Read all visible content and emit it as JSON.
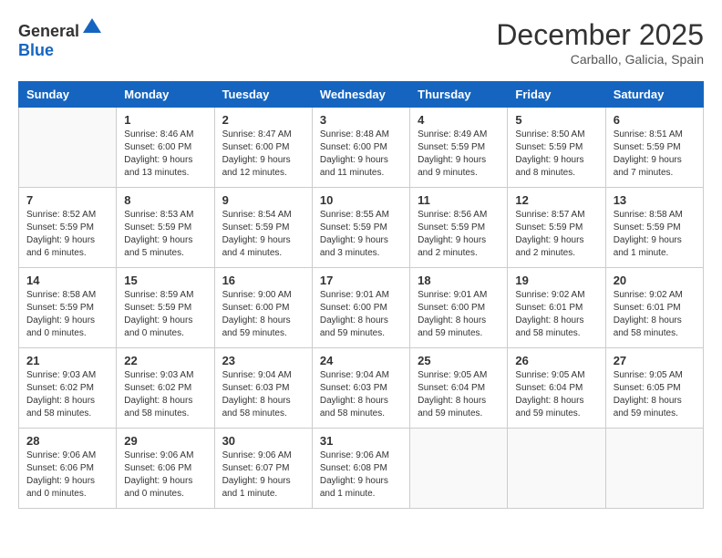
{
  "header": {
    "logo": {
      "general": "General",
      "blue": "Blue"
    },
    "title": "December 2025",
    "location": "Carballo, Galicia, Spain"
  },
  "calendar": {
    "days_of_week": [
      "Sunday",
      "Monday",
      "Tuesday",
      "Wednesday",
      "Thursday",
      "Friday",
      "Saturday"
    ],
    "weeks": [
      [
        {
          "day": "",
          "info": ""
        },
        {
          "day": "1",
          "info": "Sunrise: 8:46 AM\nSunset: 6:00 PM\nDaylight: 9 hours\nand 13 minutes."
        },
        {
          "day": "2",
          "info": "Sunrise: 8:47 AM\nSunset: 6:00 PM\nDaylight: 9 hours\nand 12 minutes."
        },
        {
          "day": "3",
          "info": "Sunrise: 8:48 AM\nSunset: 6:00 PM\nDaylight: 9 hours\nand 11 minutes."
        },
        {
          "day": "4",
          "info": "Sunrise: 8:49 AM\nSunset: 5:59 PM\nDaylight: 9 hours\nand 9 minutes."
        },
        {
          "day": "5",
          "info": "Sunrise: 8:50 AM\nSunset: 5:59 PM\nDaylight: 9 hours\nand 8 minutes."
        },
        {
          "day": "6",
          "info": "Sunrise: 8:51 AM\nSunset: 5:59 PM\nDaylight: 9 hours\nand 7 minutes."
        }
      ],
      [
        {
          "day": "7",
          "info": "Sunrise: 8:52 AM\nSunset: 5:59 PM\nDaylight: 9 hours\nand 6 minutes."
        },
        {
          "day": "8",
          "info": "Sunrise: 8:53 AM\nSunset: 5:59 PM\nDaylight: 9 hours\nand 5 minutes."
        },
        {
          "day": "9",
          "info": "Sunrise: 8:54 AM\nSunset: 5:59 PM\nDaylight: 9 hours\nand 4 minutes."
        },
        {
          "day": "10",
          "info": "Sunrise: 8:55 AM\nSunset: 5:59 PM\nDaylight: 9 hours\nand 3 minutes."
        },
        {
          "day": "11",
          "info": "Sunrise: 8:56 AM\nSunset: 5:59 PM\nDaylight: 9 hours\nand 2 minutes."
        },
        {
          "day": "12",
          "info": "Sunrise: 8:57 AM\nSunset: 5:59 PM\nDaylight: 9 hours\nand 2 minutes."
        },
        {
          "day": "13",
          "info": "Sunrise: 8:58 AM\nSunset: 5:59 PM\nDaylight: 9 hours\nand 1 minute."
        }
      ],
      [
        {
          "day": "14",
          "info": "Sunrise: 8:58 AM\nSunset: 5:59 PM\nDaylight: 9 hours\nand 0 minutes."
        },
        {
          "day": "15",
          "info": "Sunrise: 8:59 AM\nSunset: 5:59 PM\nDaylight: 9 hours\nand 0 minutes."
        },
        {
          "day": "16",
          "info": "Sunrise: 9:00 AM\nSunset: 6:00 PM\nDaylight: 8 hours\nand 59 minutes."
        },
        {
          "day": "17",
          "info": "Sunrise: 9:01 AM\nSunset: 6:00 PM\nDaylight: 8 hours\nand 59 minutes."
        },
        {
          "day": "18",
          "info": "Sunrise: 9:01 AM\nSunset: 6:00 PM\nDaylight: 8 hours\nand 59 minutes."
        },
        {
          "day": "19",
          "info": "Sunrise: 9:02 AM\nSunset: 6:01 PM\nDaylight: 8 hours\nand 58 minutes."
        },
        {
          "day": "20",
          "info": "Sunrise: 9:02 AM\nSunset: 6:01 PM\nDaylight: 8 hours\nand 58 minutes."
        }
      ],
      [
        {
          "day": "21",
          "info": "Sunrise: 9:03 AM\nSunset: 6:02 PM\nDaylight: 8 hours\nand 58 minutes."
        },
        {
          "day": "22",
          "info": "Sunrise: 9:03 AM\nSunset: 6:02 PM\nDaylight: 8 hours\nand 58 minutes."
        },
        {
          "day": "23",
          "info": "Sunrise: 9:04 AM\nSunset: 6:03 PM\nDaylight: 8 hours\nand 58 minutes."
        },
        {
          "day": "24",
          "info": "Sunrise: 9:04 AM\nSunset: 6:03 PM\nDaylight: 8 hours\nand 58 minutes."
        },
        {
          "day": "25",
          "info": "Sunrise: 9:05 AM\nSunset: 6:04 PM\nDaylight: 8 hours\nand 59 minutes."
        },
        {
          "day": "26",
          "info": "Sunrise: 9:05 AM\nSunset: 6:04 PM\nDaylight: 8 hours\nand 59 minutes."
        },
        {
          "day": "27",
          "info": "Sunrise: 9:05 AM\nSunset: 6:05 PM\nDaylight: 8 hours\nand 59 minutes."
        }
      ],
      [
        {
          "day": "28",
          "info": "Sunrise: 9:06 AM\nSunset: 6:06 PM\nDaylight: 9 hours\nand 0 minutes."
        },
        {
          "day": "29",
          "info": "Sunrise: 9:06 AM\nSunset: 6:06 PM\nDaylight: 9 hours\nand 0 minutes."
        },
        {
          "day": "30",
          "info": "Sunrise: 9:06 AM\nSunset: 6:07 PM\nDaylight: 9 hours\nand 1 minute."
        },
        {
          "day": "31",
          "info": "Sunrise: 9:06 AM\nSunset: 6:08 PM\nDaylight: 9 hours\nand 1 minute."
        },
        {
          "day": "",
          "info": ""
        },
        {
          "day": "",
          "info": ""
        },
        {
          "day": "",
          "info": ""
        }
      ]
    ]
  }
}
